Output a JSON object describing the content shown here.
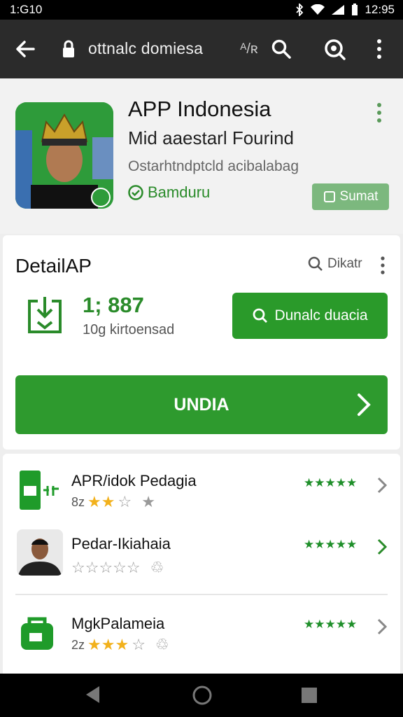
{
  "status_bar": {
    "time_left": "1:G10",
    "time_right": "12:95"
  },
  "toolbar": {
    "url": "ottnalc domiesa",
    "extra_icon_text": "ᴬ/ʀ"
  },
  "header": {
    "title": "APP Indonesia",
    "subtitle": "Mid aaestarl Fourind",
    "description": "Ostarhtndptcld acibalabag",
    "verified_label": "Bamduru",
    "action_label": "Sumat"
  },
  "detail": {
    "title": "DetailAP",
    "search_label": "Dikatr",
    "download_count": "1; 887",
    "download_label": "10g kirtoensad",
    "download_button": "Dunalc duacia",
    "main_button": "UNDIA"
  },
  "list": [
    {
      "name": "APR/idok Pedagia",
      "meta_prefix": "8z",
      "rating_filled": 2,
      "icon": "app-green-icon"
    },
    {
      "name": "Pedar-Ikiahaia",
      "meta_prefix": "",
      "rating_filled": 0,
      "icon": "person-avatar"
    },
    {
      "name": "MgkPalameia",
      "meta_prefix": "2z",
      "rating_filled": 3,
      "icon": "folder-green-icon"
    }
  ],
  "colors": {
    "accent": "#2e9a2e",
    "toolbar": "#2b2b2b",
    "star_gold": "#f2b11c"
  }
}
